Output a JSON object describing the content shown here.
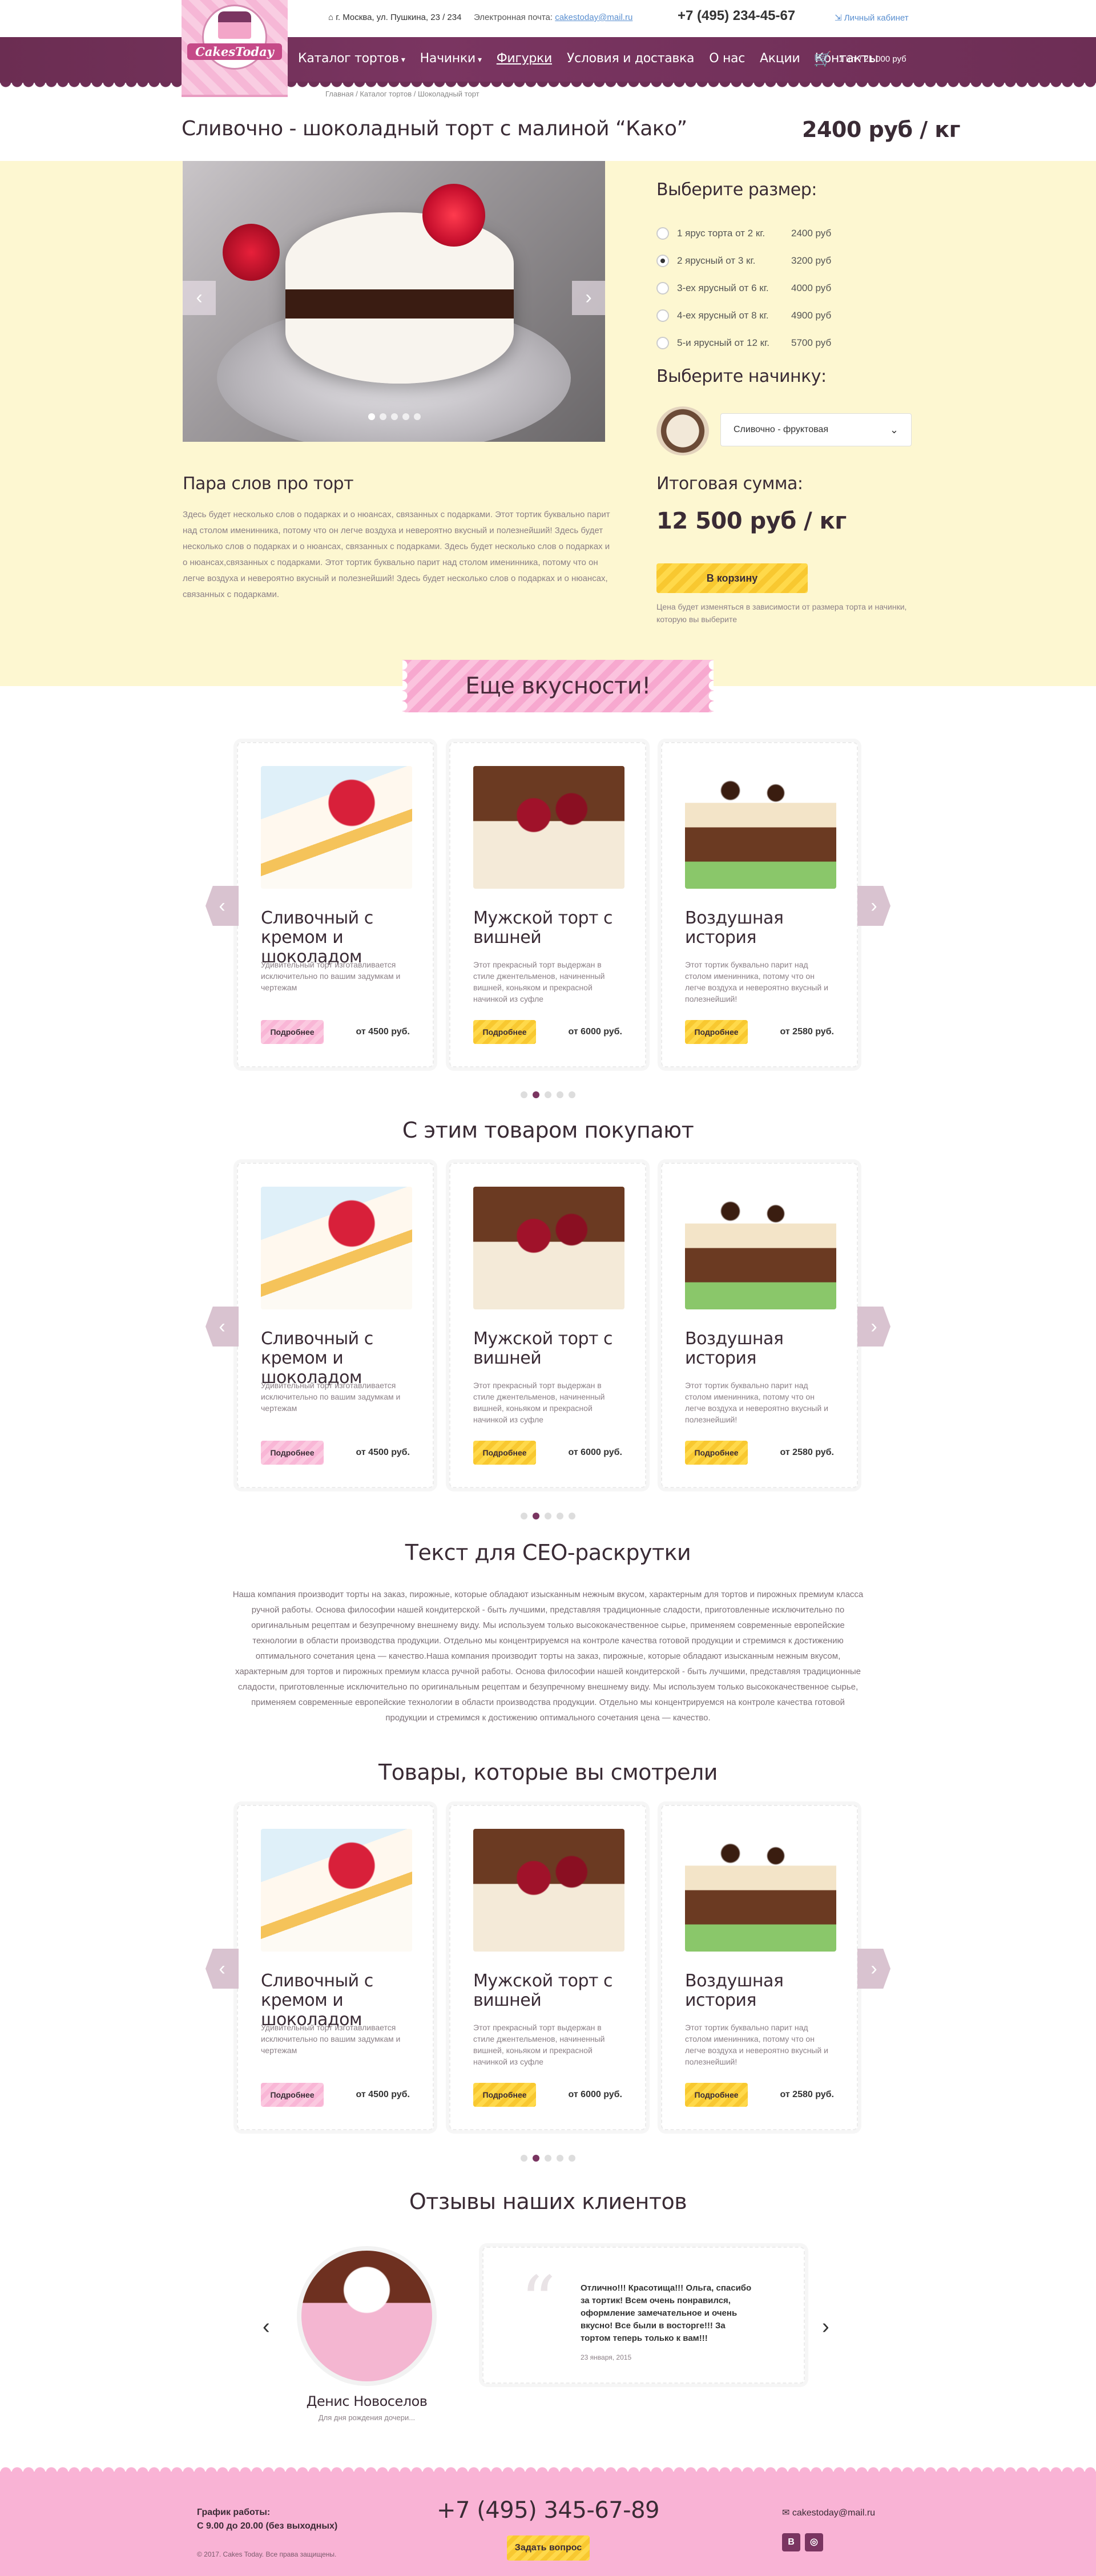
{
  "header": {
    "address": "г. Москва, ул. Пушкина, 23 / 234",
    "email_label": "Электронная почта:",
    "email": "cakestoday@mail.ru",
    "phone": "+7 (495) 234-45-67",
    "cabinet": "Личный кабинет",
    "logo_text": "CakesToday",
    "nav": [
      "Каталог тортов",
      "Начинки",
      "Фигурки",
      "Условия и доставка",
      "О нас",
      "Акции",
      "Контакты"
    ],
    "cart": "1 шт / 21 000 руб"
  },
  "breadcrumb": "Главная / Каталог тортов / Шоколадный торт",
  "product": {
    "title": "Сливочно - шоколадный торт с малиной “Како”",
    "price": "2400 руб / кг",
    "about_title": "Пара слов про торт",
    "about_text": "Здесь будет несколько слов о подарках и о нюансах, связанных с подарками. Этот тортик буквально парит над столом именинника, потому что он легче воздуха и невероятно вкусный и полезнейший! Здесь будет несколько слов о подарках и о нюансах, связанных с подарками. Здесь будет несколько слов о подарках и о нюансах,связанных с подарками. Этот тортик буквально парит над столом именинника, потому что он легче воздуха и невероятно вкусный и полезнейший! Здесь будет несколько слов о подарках и о нюансах, связанных с подарками.",
    "size_title": "Выберите размер:",
    "sizes": [
      {
        "label": "1 ярус торта от 2 кг.",
        "price": "2400 руб",
        "selected": false
      },
      {
        "label": "2 ярусный от 3 кг.",
        "price": "3200 руб",
        "selected": true
      },
      {
        "label": "3-ех ярусный от 6 кг.",
        "price": "4000 руб",
        "selected": false
      },
      {
        "label": "4-ех ярусный от 8 кг.",
        "price": "4900 руб",
        "selected": false
      },
      {
        "label": "5-и ярусный от 12 кг.",
        "price": "5700 руб",
        "selected": false
      }
    ],
    "filling_title": "Выберите начинку:",
    "filling_selected": "Сливочно - фруктовая",
    "total_title": "Итоговая сумма:",
    "total_value": "12 500 руб / кг",
    "buy_label": "В корзину",
    "buy_note": "Цена будет изменяться в зависимости от размера торта и начинки, которую вы выберите"
  },
  "cards": [
    {
      "title": "Сливочный с кремом и шоколадом",
      "desc": "Удивительный торт изготавливается исключительно по вашим задумкам и чертежам",
      "button": "Подробнее",
      "price": "от 4500 руб."
    },
    {
      "title": "Мужской торт с вишней",
      "desc": "Этот прекрасный торт выдержан в стиле джентельменов, начиненный вишней, коньяком и прекрасной начинкой из суфле",
      "button": "Подробнее",
      "price": "от 6000 руб."
    },
    {
      "title": "Воздушная история",
      "desc": "Этот тортик буквально парит над столом именинника, потому что он легче воздуха и невероятно вкусный и полезнейший!",
      "button": "Подробнее",
      "price": "от 2580 руб."
    }
  ],
  "sections": {
    "more_tasty": "Еще вкусности!",
    "bought_with": "С этим товаром покупают",
    "seo_title": "Текст для СЕО-раскрутки",
    "seo_text": "Наша компания производит торты на заказ, пирожные, которые обладают изысканным нежным вкусом, характерным для тортов и пирожных премиум класса ручной работы. Основа философии нашей кондитерской - быть лучшими, представляя традиционные сладости, приготовленные исключительно по оригинальным рецептам и безупречному внешнему виду. Мы используем только высококачественное сырье, применяем современные европейские технологии в области производства продукции. Отдельно мы концентрируемся на контроле качества готовой продукции и стремимся к достижению оптимального сочетания цена — качество.Наша компания производит торты на заказ, пирожные, которые обладают изысканным нежным вкусом, характерным для тортов и пирожных премиум класса ручной работы. Основа философии нашей кондитерской - быть лучшими, представляя традиционные сладости, приготовленные исключительно по оригинальным рецептам и безупречному внешнему виду. Мы используем только высококачественное сырье, применяем современные европейские технологии в области производства продукции. Отдельно мы концентрируемся на контроле качества готовой продукции и стремимся к достижению оптимального сочетания цена — качество.",
    "viewed": "Товары, которые вы смотрели",
    "reviews": "Отзывы наших клиентов"
  },
  "review": {
    "name": "Денис Новоселов",
    "sub": "Для дня рождения дочери...",
    "text": "Отлично!!! Красотища!!! Ольга, спасибо за тортик! Всем очень понравился, оформление замечательное и очень вкусно! Все были в восторге!!! За тортом теперь только к вам!!!",
    "date": "23 января, 2015"
  },
  "footer": {
    "hours_label": "График работы:",
    "hours": "С 9.00 до 20.00 (без выходных)",
    "copyright": "© 2017. Cakes Today. Все права защищены.",
    "phone": "+7 (495) 345-67-89",
    "ask": "Задать вопрос",
    "email": "cakestoday@mail.ru",
    "social": [
      "В",
      "◎"
    ]
  }
}
